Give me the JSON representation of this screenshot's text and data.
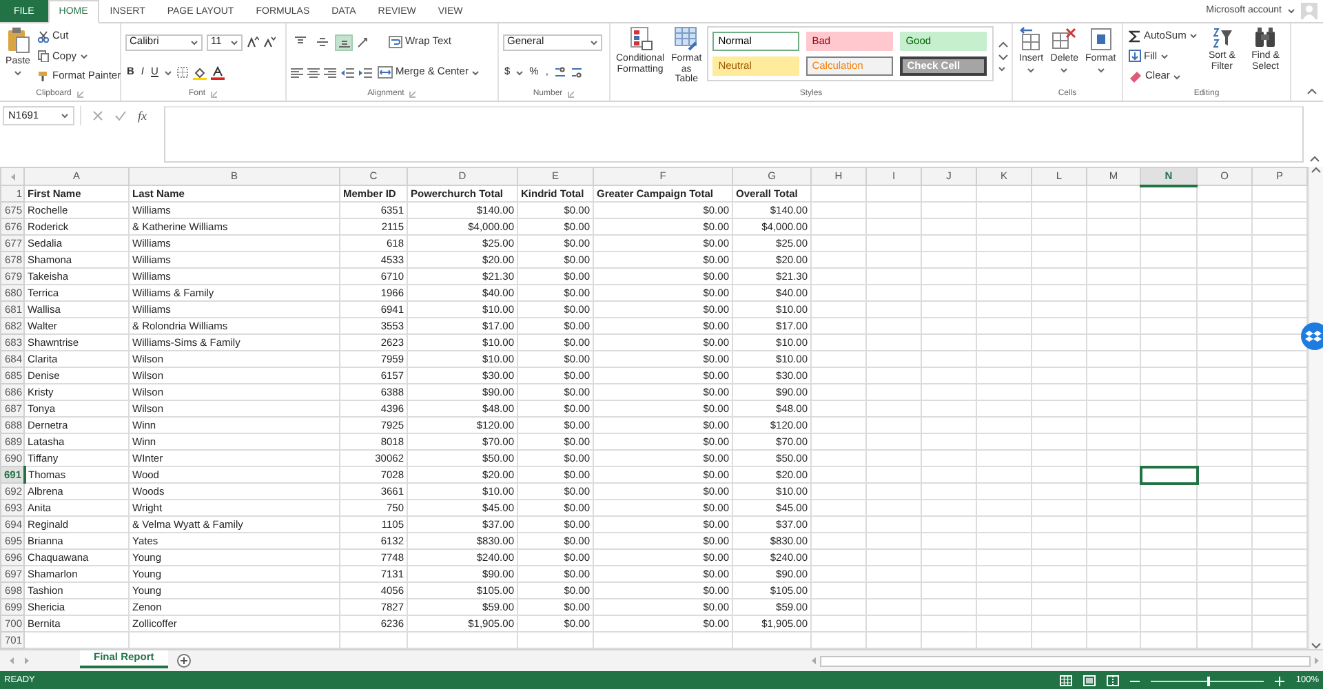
{
  "tabs": [
    {
      "label": "FILE",
      "kind": "file",
      "selected": false
    },
    {
      "label": "HOME",
      "kind": "tab",
      "selected": true
    },
    {
      "label": "INSERT",
      "kind": "tab",
      "selected": false
    },
    {
      "label": "PAGE LAYOUT",
      "kind": "tab",
      "selected": false
    },
    {
      "label": "FORMULAS",
      "kind": "tab",
      "selected": false
    },
    {
      "label": "DATA",
      "kind": "tab",
      "selected": false
    },
    {
      "label": "REVIEW",
      "kind": "tab",
      "selected": false
    },
    {
      "label": "VIEW",
      "kind": "tab",
      "selected": false
    }
  ],
  "account": "Microsoft account",
  "ribbon": {
    "clipboard": {
      "paste": "Paste",
      "cut": "Cut",
      "copy": "Copy",
      "format_painter": "Format Painter",
      "label": "Clipboard"
    },
    "font": {
      "name": "Calibri",
      "size": "11",
      "styles": [
        "B",
        "I",
        "U"
      ],
      "label": "Font"
    },
    "alignment": {
      "vertical": [
        {
          "selected": false
        },
        {
          "selected": false
        },
        {
          "selected": true
        }
      ],
      "wrap": "Wrap Text",
      "merge": "Merge & Center",
      "label": "Alignment"
    },
    "number": {
      "format": "General",
      "symbols": [
        "$",
        "%",
        ","
      ],
      "label": "Number"
    },
    "styles": {
      "conditional": "Conditional Formatting",
      "format_table": "Format as Table",
      "cells": [
        {
          "name": "Normal",
          "kind": "normal"
        },
        {
          "name": "Bad",
          "kind": "bad"
        },
        {
          "name": "Good",
          "kind": "good"
        },
        {
          "name": "Neutral",
          "kind": "neutral"
        },
        {
          "name": "Calculation",
          "kind": "calculation"
        },
        {
          "name": "Check Cell",
          "kind": "check"
        }
      ],
      "label": "Styles"
    },
    "cells": {
      "buttons": [
        "Insert",
        "Delete",
        "Format"
      ],
      "label": "Cells"
    },
    "editing": {
      "autosum": "AutoSum",
      "fill": "Fill",
      "clear": "Clear",
      "sort": "Sort & Filter",
      "find": "Find & Select",
      "label": "Editing"
    }
  },
  "formula_bar": {
    "name_box": "N1691",
    "function_label": "fx"
  },
  "columns": [
    {
      "label": "A",
      "selected": false
    },
    {
      "label": "B",
      "selected": false
    },
    {
      "label": "C",
      "selected": false
    },
    {
      "label": "D",
      "selected": false
    },
    {
      "label": "E",
      "selected": false
    },
    {
      "label": "F",
      "selected": false
    },
    {
      "label": "G",
      "selected": false
    },
    {
      "label": "H",
      "selected": false
    },
    {
      "label": "I",
      "selected": false
    },
    {
      "label": "J",
      "selected": false
    },
    {
      "label": "K",
      "selected": false
    },
    {
      "label": "L",
      "selected": false
    },
    {
      "label": "M",
      "selected": false
    },
    {
      "label": "N",
      "selected": true
    },
    {
      "label": "O",
      "selected": false
    },
    {
      "label": "P",
      "selected": false
    }
  ],
  "header_row": {
    "number": "1",
    "cells": [
      "First Name",
      "Last Name",
      "Member ID",
      "Powerchurch Total",
      "Kindrid Total",
      "Greater Campaign Total",
      "Overall Total"
    ]
  },
  "rows": [
    {
      "number": "675",
      "selected": false,
      "cells": [
        "Rochelle",
        "Williams",
        "6351",
        "$140.00",
        "$0.00",
        "$0.00",
        "$140.00"
      ]
    },
    {
      "number": "676",
      "selected": false,
      "cells": [
        "Roderick",
        "& Katherine Williams",
        "2115",
        "$4,000.00",
        "$0.00",
        "$0.00",
        "$4,000.00"
      ]
    },
    {
      "number": "677",
      "selected": false,
      "cells": [
        "Sedalia",
        "Williams",
        "618",
        "$25.00",
        "$0.00",
        "$0.00",
        "$25.00"
      ]
    },
    {
      "number": "678",
      "selected": false,
      "cells": [
        "Shamona",
        "Williams",
        "4533",
        "$20.00",
        "$0.00",
        "$0.00",
        "$20.00"
      ]
    },
    {
      "number": "679",
      "selected": false,
      "cells": [
        "Takeisha",
        "Williams",
        "6710",
        "$21.30",
        "$0.00",
        "$0.00",
        "$21.30"
      ]
    },
    {
      "number": "680",
      "selected": false,
      "cells": [
        "Terrica",
        "Williams & Family",
        "1966",
        "$40.00",
        "$0.00",
        "$0.00",
        "$40.00"
      ]
    },
    {
      "number": "681",
      "selected": false,
      "cells": [
        "Wallisa",
        "Williams",
        "6941",
        "$10.00",
        "$0.00",
        "$0.00",
        "$10.00"
      ]
    },
    {
      "number": "682",
      "selected": false,
      "cells": [
        "Walter",
        "& Rolondria Williams",
        "3553",
        "$17.00",
        "$0.00",
        "$0.00",
        "$17.00"
      ]
    },
    {
      "number": "683",
      "selected": false,
      "cells": [
        "Shawntrise",
        "Williams-Sims & Family",
        "2623",
        "$10.00",
        "$0.00",
        "$0.00",
        "$10.00"
      ]
    },
    {
      "number": "684",
      "selected": false,
      "cells": [
        "Clarita",
        "Wilson",
        "7959",
        "$10.00",
        "$0.00",
        "$0.00",
        "$10.00"
      ]
    },
    {
      "number": "685",
      "selected": false,
      "cells": [
        "Denise",
        "Wilson",
        "6157",
        "$30.00",
        "$0.00",
        "$0.00",
        "$30.00"
      ]
    },
    {
      "number": "686",
      "selected": false,
      "cells": [
        "Kristy",
        "Wilson",
        "6388",
        "$90.00",
        "$0.00",
        "$0.00",
        "$90.00"
      ]
    },
    {
      "number": "687",
      "selected": false,
      "cells": [
        "Tonya",
        "Wilson",
        "4396",
        "$48.00",
        "$0.00",
        "$0.00",
        "$48.00"
      ]
    },
    {
      "number": "688",
      "selected": false,
      "cells": [
        "Dernetra",
        "Winn",
        "7925",
        "$120.00",
        "$0.00",
        "$0.00",
        "$120.00"
      ]
    },
    {
      "number": "689",
      "selected": false,
      "cells": [
        "Latasha",
        "Winn",
        "8018",
        "$70.00",
        "$0.00",
        "$0.00",
        "$70.00"
      ]
    },
    {
      "number": "690",
      "selected": false,
      "cells": [
        "Tiffany",
        "WInter",
        "30062",
        "$50.00",
        "$0.00",
        "$0.00",
        "$50.00"
      ]
    },
    {
      "number": "691",
      "selected": true,
      "cells": [
        "Thomas",
        "Wood",
        "7028",
        "$20.00",
        "$0.00",
        "$0.00",
        "$20.00"
      ]
    },
    {
      "number": "692",
      "selected": false,
      "cells": [
        "Albrena",
        "Woods",
        "3661",
        "$10.00",
        "$0.00",
        "$0.00",
        "$10.00"
      ]
    },
    {
      "number": "693",
      "selected": false,
      "cells": [
        "Anita",
        "Wright",
        "750",
        "$45.00",
        "$0.00",
        "$0.00",
        "$45.00"
      ]
    },
    {
      "number": "694",
      "selected": false,
      "cells": [
        "Reginald",
        "& Velma Wyatt & Family",
        "1105",
        "$37.00",
        "$0.00",
        "$0.00",
        "$37.00"
      ]
    },
    {
      "number": "695",
      "selected": false,
      "cells": [
        "Brianna",
        "Yates",
        "6132",
        "$830.00",
        "$0.00",
        "$0.00",
        "$830.00"
      ]
    },
    {
      "number": "696",
      "selected": false,
      "cells": [
        "Chaquawana",
        "Young",
        "7748",
        "$240.00",
        "$0.00",
        "$0.00",
        "$240.00"
      ]
    },
    {
      "number": "697",
      "selected": false,
      "cells": [
        "Shamarlon",
        "Young",
        "7131",
        "$90.00",
        "$0.00",
        "$0.00",
        "$90.00"
      ]
    },
    {
      "number": "698",
      "selected": false,
      "cells": [
        "Tashion",
        "Young",
        "4056",
        "$105.00",
        "$0.00",
        "$0.00",
        "$105.00"
      ]
    },
    {
      "number": "699",
      "selected": false,
      "cells": [
        "Shericia",
        "Zenon",
        "7827",
        "$59.00",
        "$0.00",
        "$0.00",
        "$59.00"
      ]
    },
    {
      "number": "700",
      "selected": false,
      "cells": [
        "Bernita",
        "Zollicoffer",
        "6236",
        "$1,905.00",
        "$0.00",
        "$0.00",
        "$1,905.00"
      ]
    },
    {
      "number": "701",
      "selected": false,
      "cells": []
    }
  ],
  "sheet_tabs": [
    {
      "label": "Final Report",
      "selected": true
    }
  ],
  "status_bar": {
    "status": "READY",
    "zoom": {
      "level": 0.5,
      "reading": "100%"
    }
  }
}
